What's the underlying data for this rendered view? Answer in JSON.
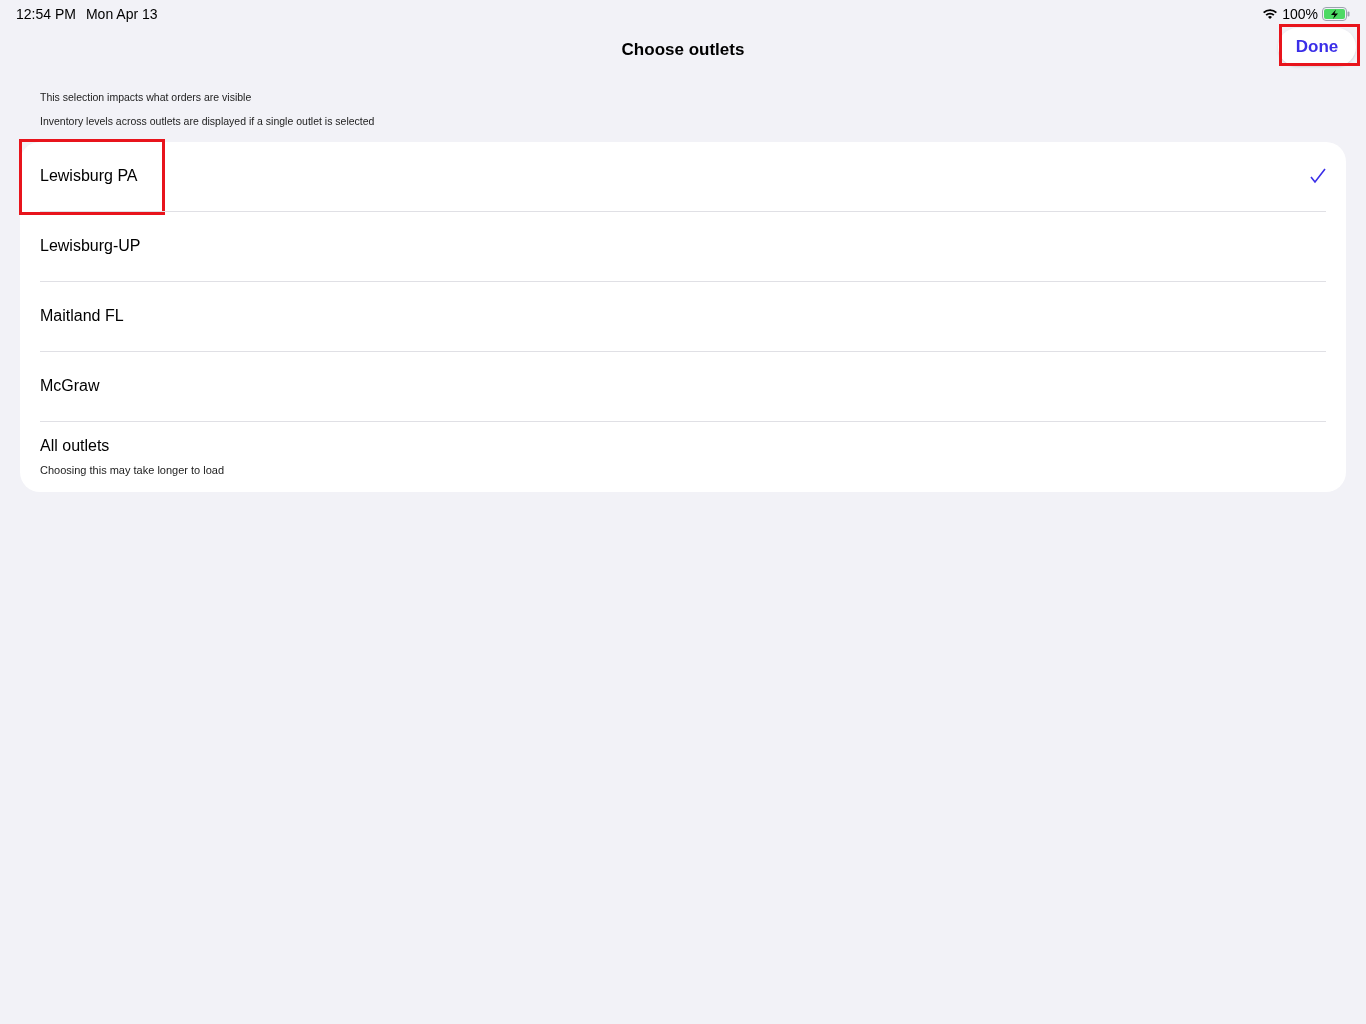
{
  "status_bar": {
    "time": "12:54 PM",
    "date": "Mon Apr 13",
    "battery": "100%"
  },
  "header": {
    "title": "Choose outlets",
    "done_button": {
      "label": "Done",
      "highlighted": true
    }
  },
  "notes": [
    "This selection impacts what orders are visible",
    "Inventory levels across outlets are displayed if a single outlet is selected"
  ],
  "outlets": [
    {
      "label": "Lewisburg PA",
      "selected": true,
      "highlighted": true
    },
    {
      "label": "Lewisburg-UP",
      "selected": false,
      "highlighted": false
    },
    {
      "label": "Maitland FL",
      "selected": false,
      "highlighted": false
    },
    {
      "label": "McGraw",
      "selected": false,
      "highlighted": false
    },
    {
      "label": "All outlets",
      "subtitle": "Choosing this may take longer to load",
      "selected": false,
      "highlighted": false
    }
  ]
}
